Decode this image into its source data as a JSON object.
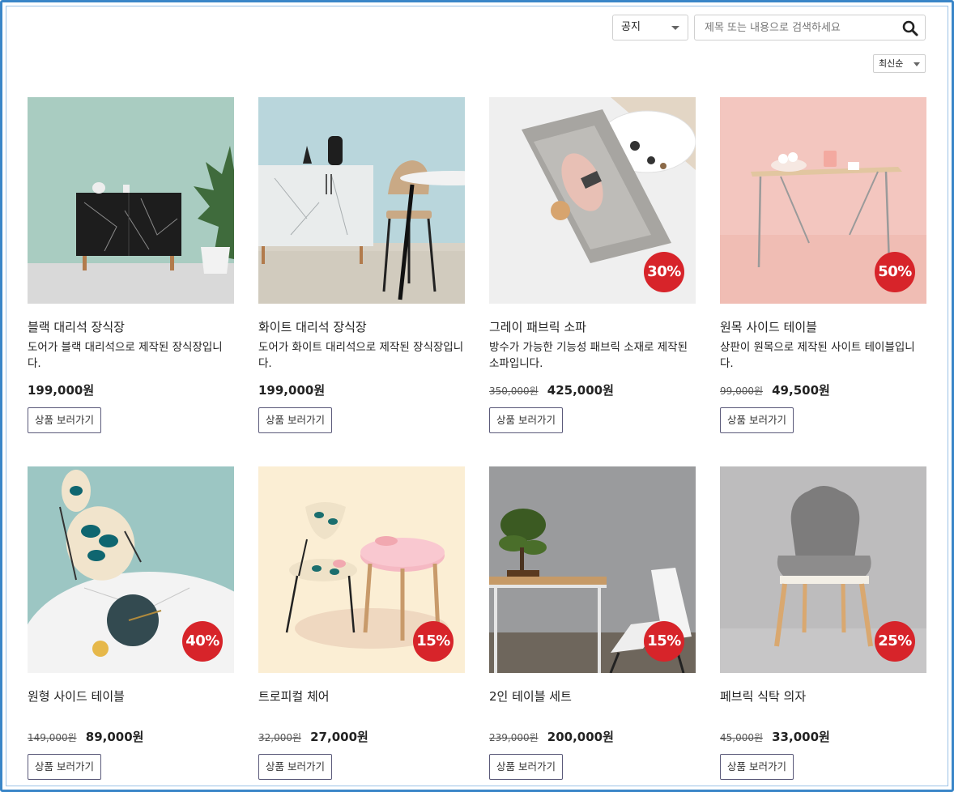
{
  "filter": {
    "category_value": "공지"
  },
  "search": {
    "placeholder": "제목 또는 내용으로 검색하세요",
    "value": ""
  },
  "sort": {
    "value": "최신순"
  },
  "colors": {
    "badge": "#d7242a",
    "frame": "#3a86c8",
    "button_border": "#5b5a7a"
  },
  "products": [
    {
      "name": "블랙 대리석 장식장",
      "description": "도어가 블랙 대리석으로 제작된 장식장입니다.",
      "original_price": "",
      "price": "199,000원",
      "discount": "",
      "button": "상품 보러가기"
    },
    {
      "name": "화이트 대리석 장식장",
      "description": "도어가 화이트 대리석으로 제작된 장식장입니다.",
      "original_price": "",
      "price": "199,000원",
      "discount": "",
      "button": "상품 보러가기"
    },
    {
      "name": "그레이 패브릭 소파",
      "description": "방수가 가능한 기능성 패브릭 소재로 제작된 소파입니다.",
      "original_price": "350,000원",
      "price": "425,000원",
      "discount": "30%",
      "button": "상품 보러가기"
    },
    {
      "name": "원목 사이드 테이블",
      "description": "상판이 원목으로 제작된 사이트 테이블입니다.",
      "original_price": "99,000원",
      "price": "49,500원",
      "discount": "50%",
      "button": "상품 보러가기"
    },
    {
      "name": "원형 사이드 테이블",
      "description": "",
      "original_price": "149,000원",
      "price": "89,000원",
      "discount": "40%",
      "button": "상품 보러가기"
    },
    {
      "name": "트로피컬 체어",
      "description": "",
      "original_price": "32,000원",
      "price": "27,000원",
      "discount": "15%",
      "button": "상품 보러가기"
    },
    {
      "name": "2인 테이블 세트",
      "description": "",
      "original_price": "239,000원",
      "price": "200,000원",
      "discount": "15%",
      "button": "상품 보러가기"
    },
    {
      "name": "페브릭 식탁 의자",
      "description": "",
      "original_price": "45,000원",
      "price": "33,000원",
      "discount": "25%",
      "button": "상품 보러가기"
    }
  ]
}
